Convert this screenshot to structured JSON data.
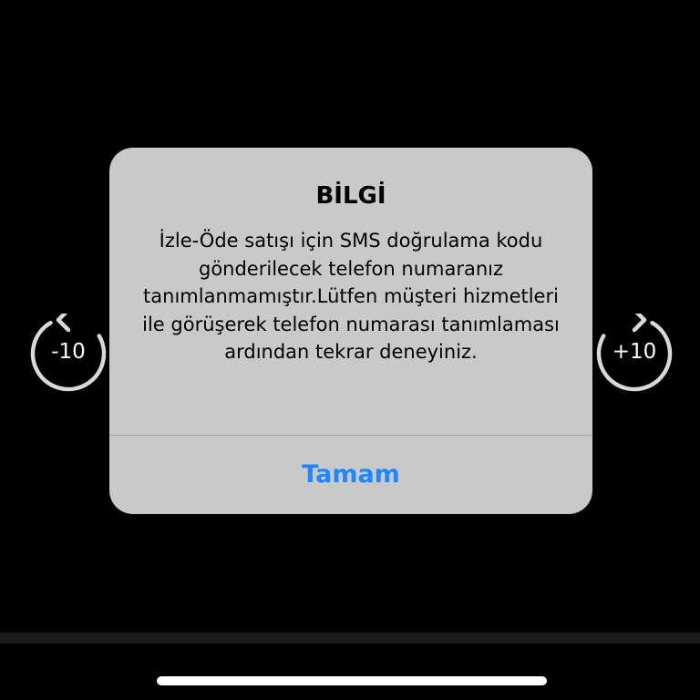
{
  "player": {
    "rewind": {
      "label": "-10",
      "icon": "rewind-10-icon"
    },
    "forward": {
      "label": "+10",
      "icon": "forward-10-icon"
    }
  },
  "alert": {
    "title": "BİLGİ",
    "message": "İzle-Öde satışı için SMS doğrulama kodu gönderilecek telefon numaranız tanımlanmamıştır.Lütfen müşteri hizmetleri ile görüşerek telefon numarası tanımlaması ardından tekrar deneyiniz.",
    "button_label": "Tamam"
  },
  "colors": {
    "background": "#000000",
    "alert_background": "#c9c9c9",
    "button_text": "#1e86ff",
    "control_stroke": "#d9d9d9"
  }
}
